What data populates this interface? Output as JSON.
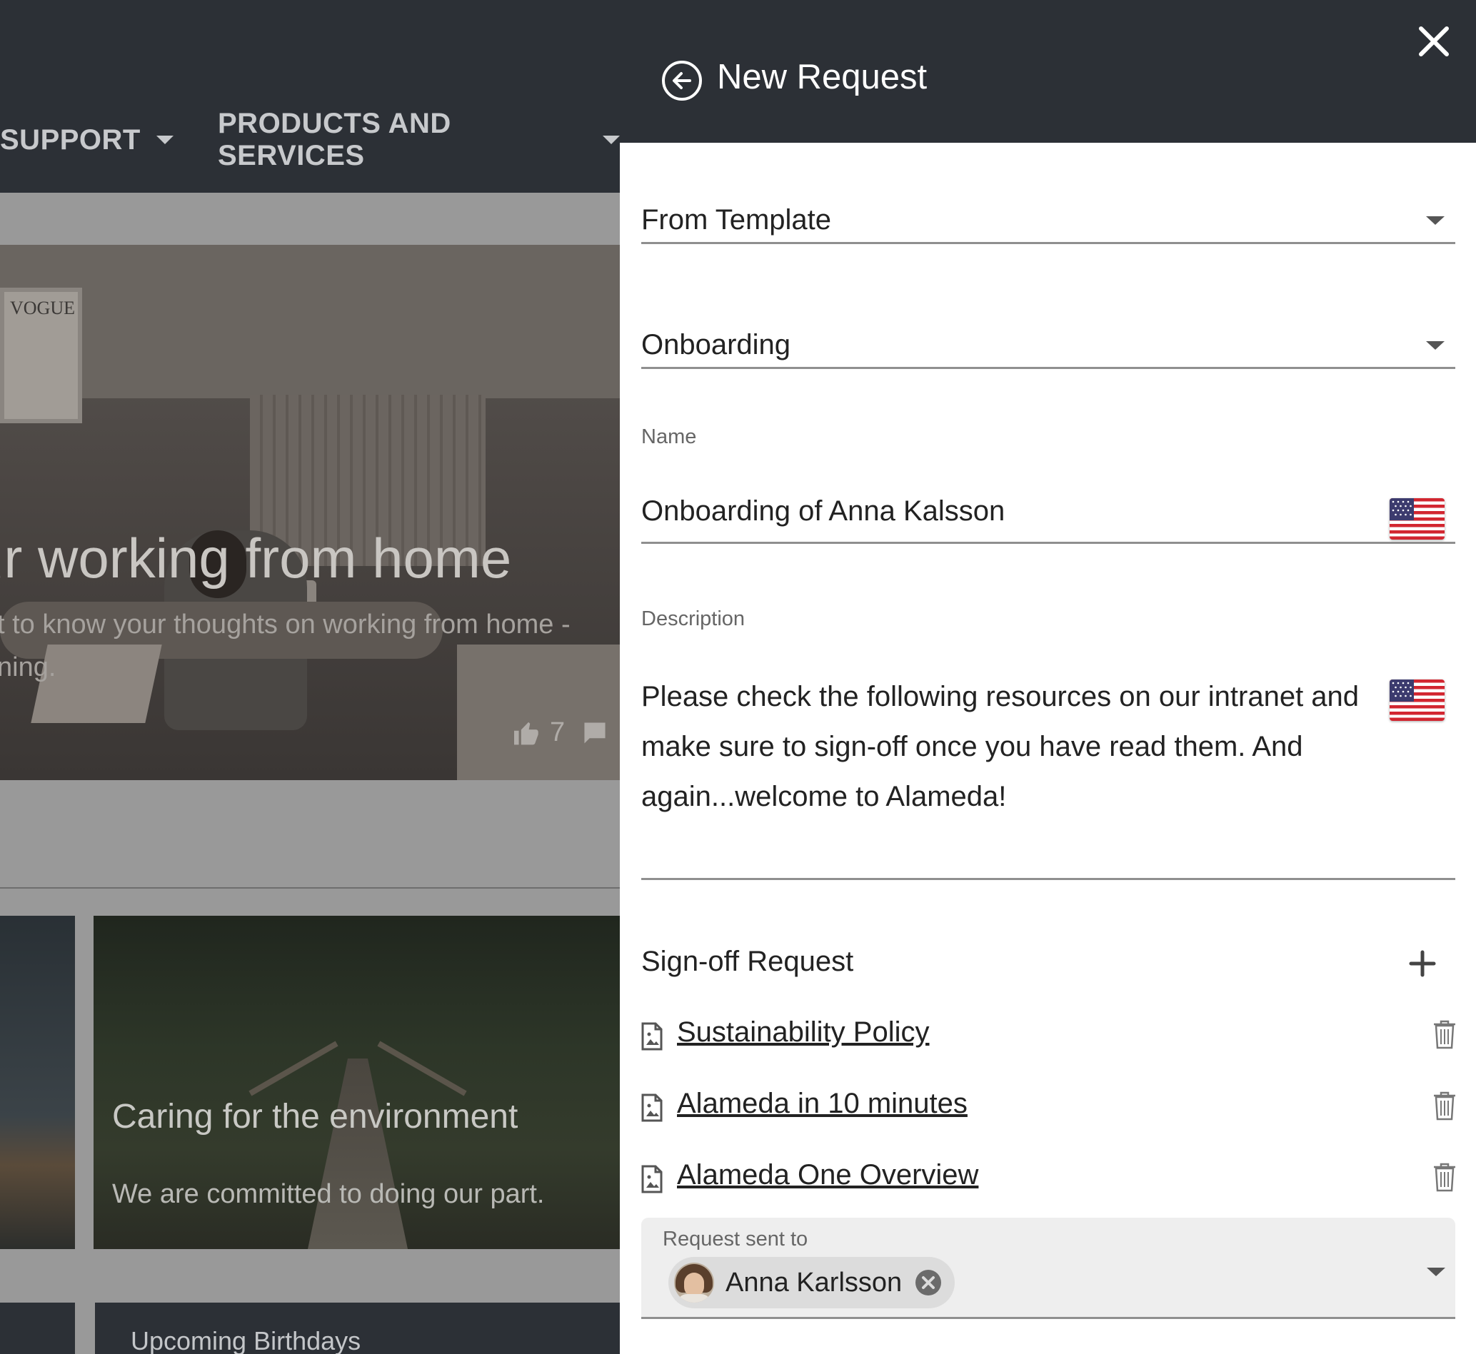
{
  "background": {
    "nav": {
      "items": [
        {
          "label": "SUPPORT"
        },
        {
          "label": "PRODUCTS AND SERVICES"
        }
      ]
    },
    "hero": {
      "poster_text": "VOGUE",
      "title": "ur working from home",
      "subtitle_line1": "t to know your thoughts on working from home -",
      "subtitle_line2": "ning.",
      "likes": "7"
    },
    "cards": {
      "environment": {
        "title": "Caring for the environment",
        "subtitle": "We are committed to doing our part."
      },
      "birthdays": {
        "title": "Upcoming Birthdays"
      }
    }
  },
  "panel": {
    "title": "New Request",
    "from_template": {
      "value": "From Template"
    },
    "template_choice": {
      "value": "Onboarding"
    },
    "name": {
      "label": "Name",
      "value": "Onboarding of Anna Kalsson"
    },
    "description": {
      "label": "Description",
      "value": "Please check the following resources on our intranet and make sure to sign-off once you have read them. And again...welcome to Alameda!"
    },
    "signoff": {
      "title": "Sign-off Request",
      "documents": [
        {
          "label": "Sustainability Policy"
        },
        {
          "label": "Alameda in 10 minutes"
        },
        {
          "label": "Alameda One Overview"
        }
      ]
    },
    "request_sent_to": {
      "label": "Request sent to",
      "recipient": "Anna Karlsson"
    }
  },
  "colors": {
    "header_bg": "#2c3036",
    "panel_bg": "#ffffff",
    "overlay_bg": "#999999",
    "text_primary": "#222222",
    "text_label": "#666666"
  },
  "icons": {
    "back": "arrow-left-circle-icon",
    "close": "close-icon",
    "flag": "us-flag-icon",
    "add": "plus-icon",
    "document": "document-image-icon",
    "delete": "trash-icon",
    "remove_chip": "close-circle-icon",
    "like": "thumbs-up-icon",
    "comment": "comment-icon"
  }
}
